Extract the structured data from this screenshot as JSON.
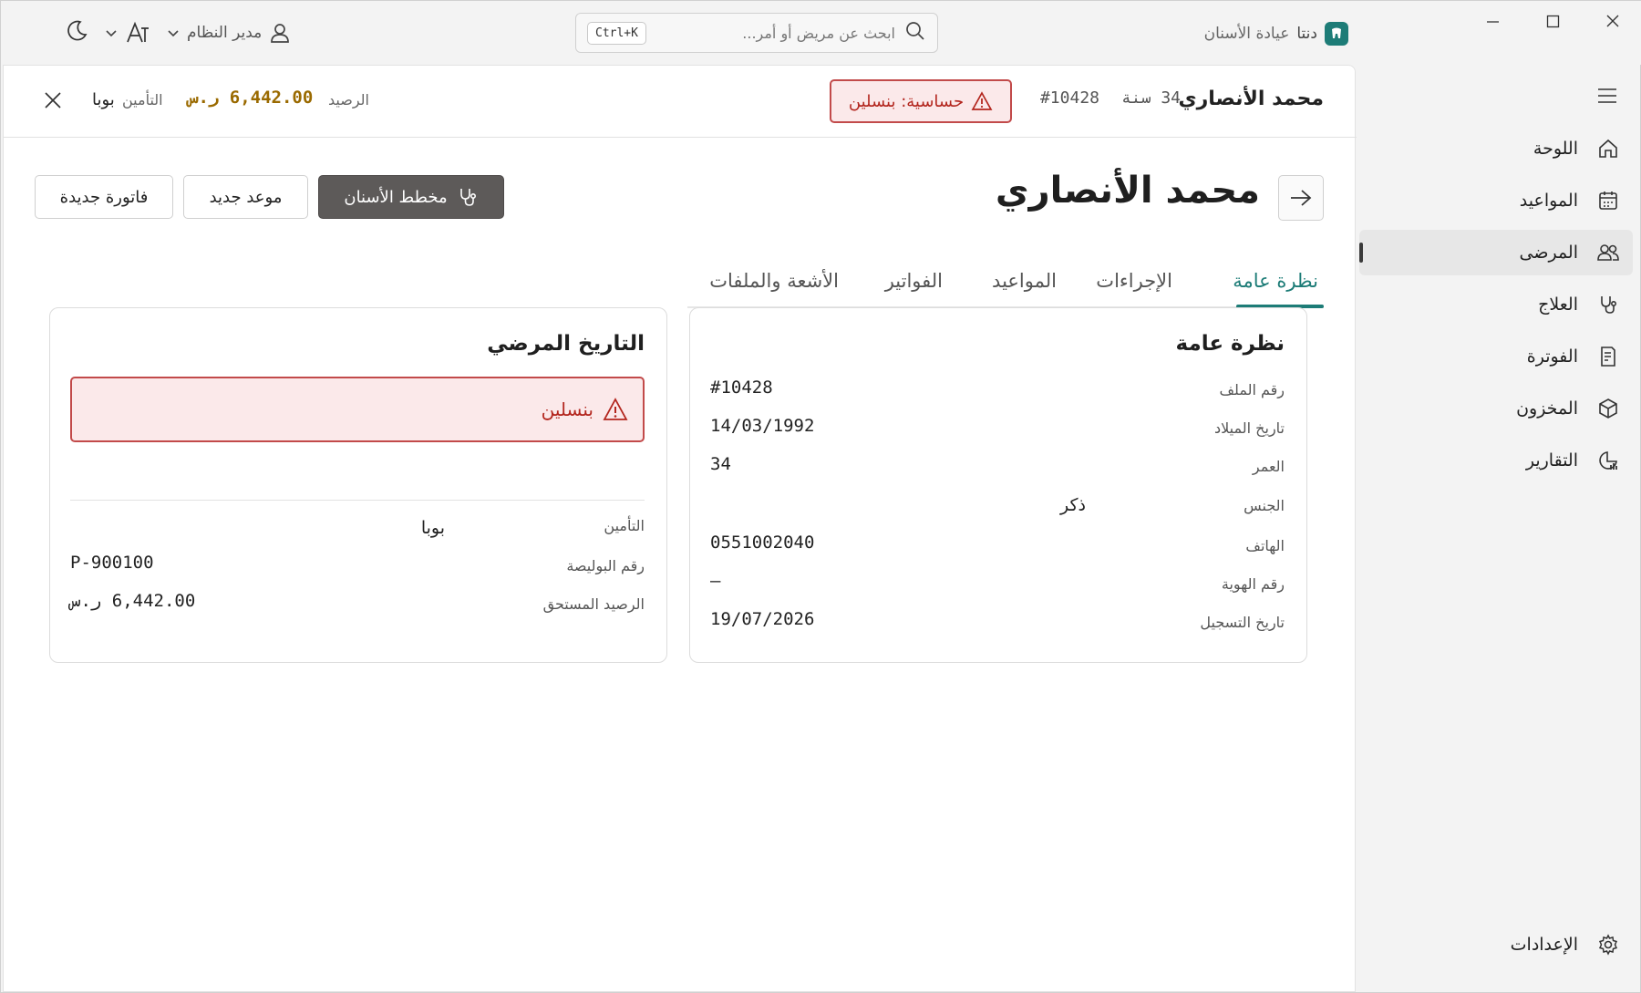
{
  "titlebar": {
    "app_name": "دنتا",
    "app_subtitle": "عيادة الأسنان",
    "search_placeholder": "ابحث عن مريض أو أمر...",
    "search_shortcut": "Ctrl+K",
    "user_name": "مدير النظام",
    "icons": [
      "logo-icon",
      "search-icon",
      "user-icon",
      "chevron-down-icon",
      "text-size-icon",
      "moon-icon",
      "minimize-icon",
      "maximize-icon",
      "close-icon"
    ]
  },
  "sidebar": {
    "items": [
      {
        "label": "اللوحة",
        "icon": "home-icon"
      },
      {
        "label": "المواعيد",
        "icon": "calendar-icon"
      },
      {
        "label": "المرضى",
        "icon": "people-icon",
        "active": true
      },
      {
        "label": "العلاج",
        "icon": "stethoscope-icon"
      },
      {
        "label": "الفوترة",
        "icon": "invoice-icon"
      },
      {
        "label": "المخزون",
        "icon": "box-icon"
      },
      {
        "label": "التقارير",
        "icon": "chart-icon"
      }
    ],
    "settings_label": "الإعدادات"
  },
  "context_bar": {
    "patient_name": "محمد الأنصاري",
    "age": "34 سنة",
    "file_no": "#10428",
    "allergy_chip": "حساسية: بنسلين",
    "balance_label": "الرصيد",
    "balance_value": "6,442.00 ر.س",
    "insurance_label": "التأمين",
    "insurance_value": "بوبا"
  },
  "page": {
    "title": "محمد الأنصاري",
    "buttons": {
      "dental_chart": "مخطط الأسنان",
      "new_appointment": "موعد جديد",
      "new_invoice": "فاتورة جديدة"
    },
    "tabs": [
      "نظرة عامة",
      "الإجراءات",
      "المواعيد",
      "الفواتير",
      "الأشعة والملفات"
    ]
  },
  "overview": {
    "title": "نظرة عامة",
    "rows": [
      {
        "label": "رقم الملف",
        "value": "#10428"
      },
      {
        "label": "تاريخ الميلاد",
        "value": "14/03/1992"
      },
      {
        "label": "العمر",
        "value": "34"
      },
      {
        "label": "الجنس",
        "value": "ذكر"
      },
      {
        "label": "الهاتف",
        "value": "0551002040"
      },
      {
        "label": "رقم الهوية",
        "value": "—"
      },
      {
        "label": "تاريخ التسجيل",
        "value": "19/07/2026"
      }
    ]
  },
  "history": {
    "title": "التاريخ المرضي",
    "allergy": "بنسلين",
    "rows": [
      {
        "label": "التأمين",
        "value": "بوبا"
      },
      {
        "label": "رقم البوليصة",
        "value": "P-900100"
      },
      {
        "label": "الرصيد المستحق",
        "value": "6,442.00 ر.س"
      }
    ]
  },
  "colors": {
    "accent": "#1d7c77",
    "danger": "#b3261e",
    "balance": "#9a6a00",
    "primary_button": "#5d5a59"
  }
}
